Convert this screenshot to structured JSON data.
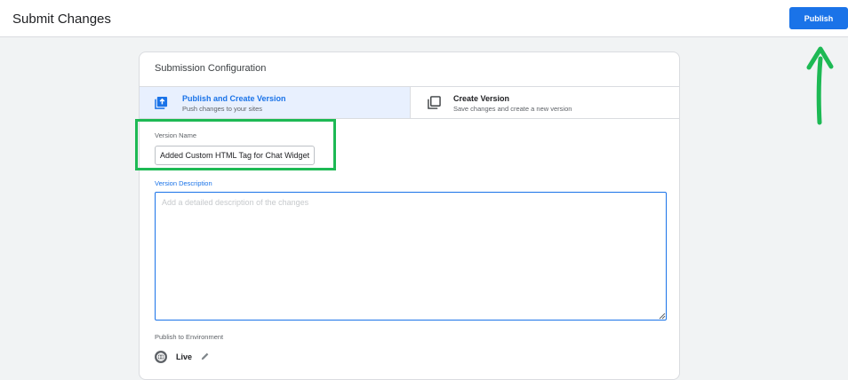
{
  "header": {
    "title": "Submit Changes",
    "publish_label": "Publish"
  },
  "card": {
    "title": "Submission Configuration",
    "tabs": [
      {
        "label": "Publish and Create Version",
        "subtitle": "Push changes to your sites",
        "icon": "publish-version-icon",
        "selected": true
      },
      {
        "label": "Create Version",
        "subtitle": "Save changes and create a new version",
        "icon": "create-version-icon",
        "selected": false
      }
    ],
    "version_name": {
      "label": "Version Name",
      "value": "Added Custom HTML Tag for Chat Widget"
    },
    "version_description": {
      "label": "Version Description",
      "placeholder": "Add a detailed description of the changes"
    },
    "environment": {
      "label": "Publish to Environment",
      "name": "Live",
      "icon": "live-environment-icon",
      "edit_icon": "pencil-icon"
    }
  },
  "colors": {
    "accent": "#1a73e8",
    "selected_tab_bg": "#e8f0fe",
    "highlight_annotation": "#1db954"
  }
}
